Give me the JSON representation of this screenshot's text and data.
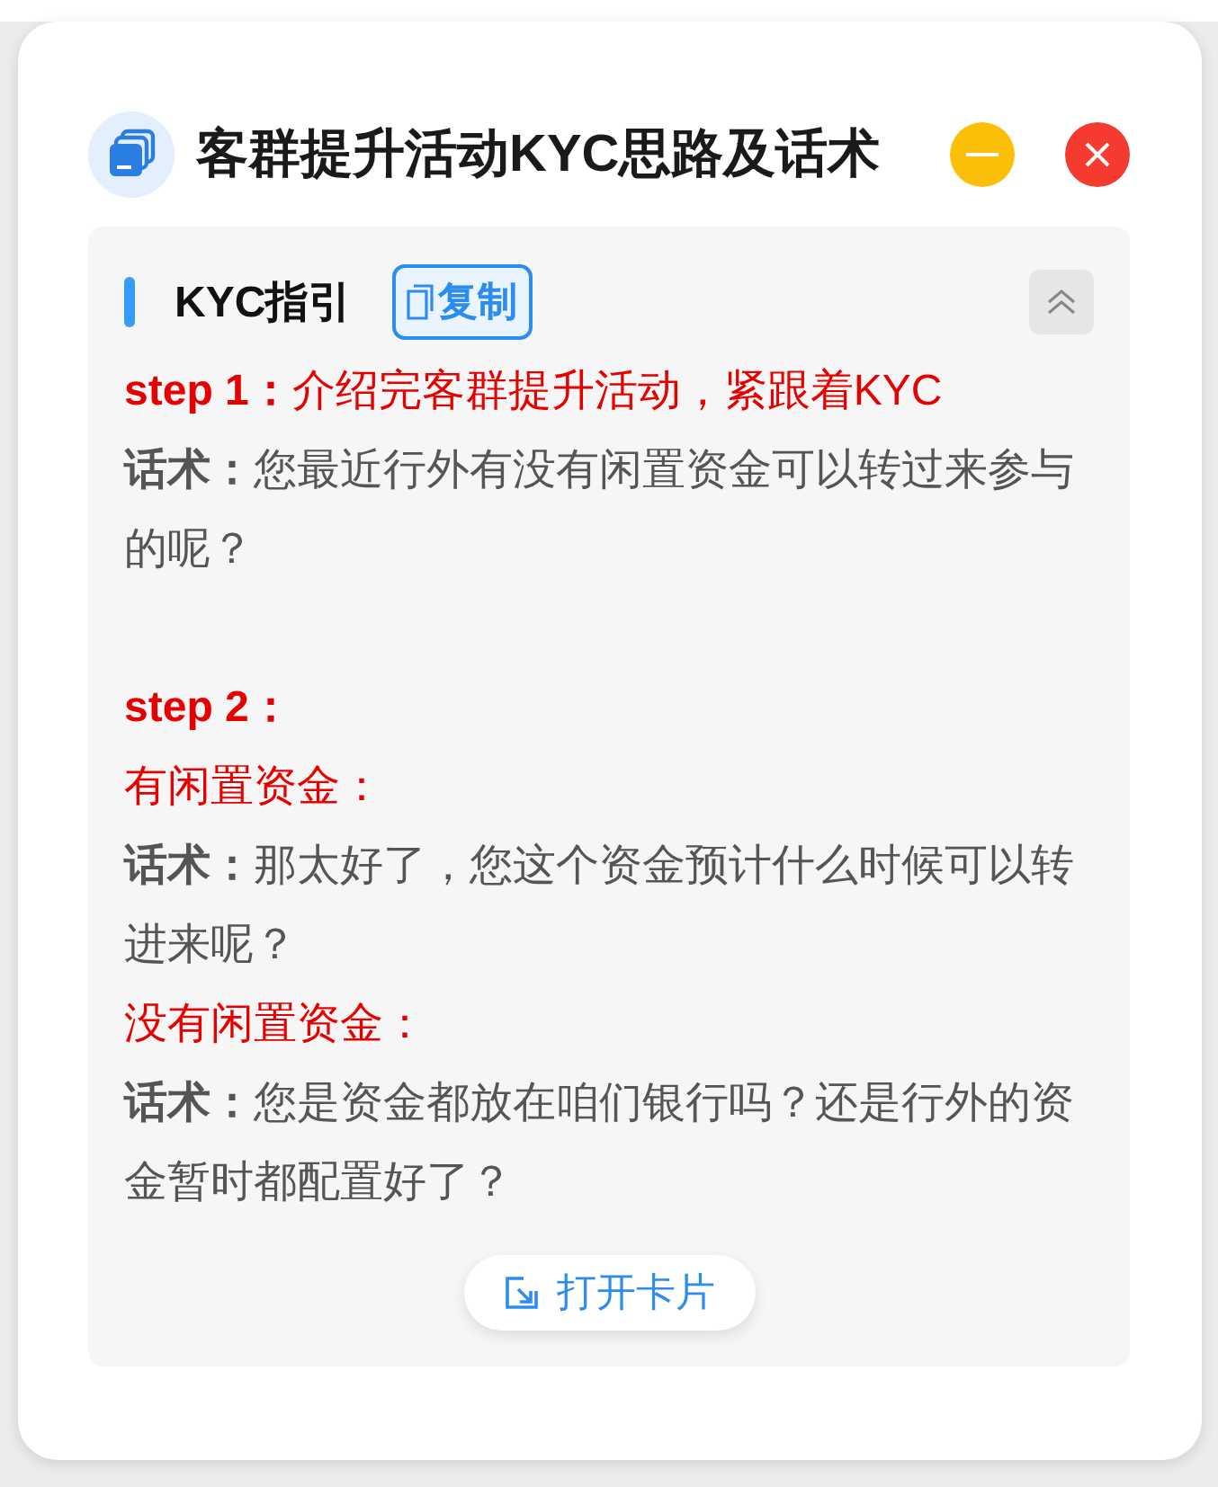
{
  "window": {
    "title": "客群提升活动KYC思路及话术"
  },
  "section": {
    "title": "KYC指引",
    "copy_button": "复制",
    "expanded": true,
    "lines": [
      {
        "kind": "step",
        "text": "**step 1：**介绍完客群提升活动，紧跟着KYC",
        "spaced": false
      },
      {
        "kind": "script",
        "text": "**话术：**您最近行外有没有闲置资金可以转过来参与的呢？",
        "spaced": false
      },
      {
        "kind": "step",
        "text": "**step 2：**",
        "spaced": true
      },
      {
        "kind": "case",
        "text": "有闲置资金：",
        "spaced": false
      },
      {
        "kind": "script",
        "text": "**话术：**那太好了，您这个资金预计什么时候可以转进来呢？",
        "spaced": false
      },
      {
        "kind": "case",
        "text": "没有闲置资金：",
        "spaced": false
      },
      {
        "kind": "script",
        "text": "**话术：**您是资金都放在咱们银行吗？还是行外的资金暂时都配置好了？",
        "spaced": false
      }
    ],
    "open_button": "打开卡片"
  }
}
